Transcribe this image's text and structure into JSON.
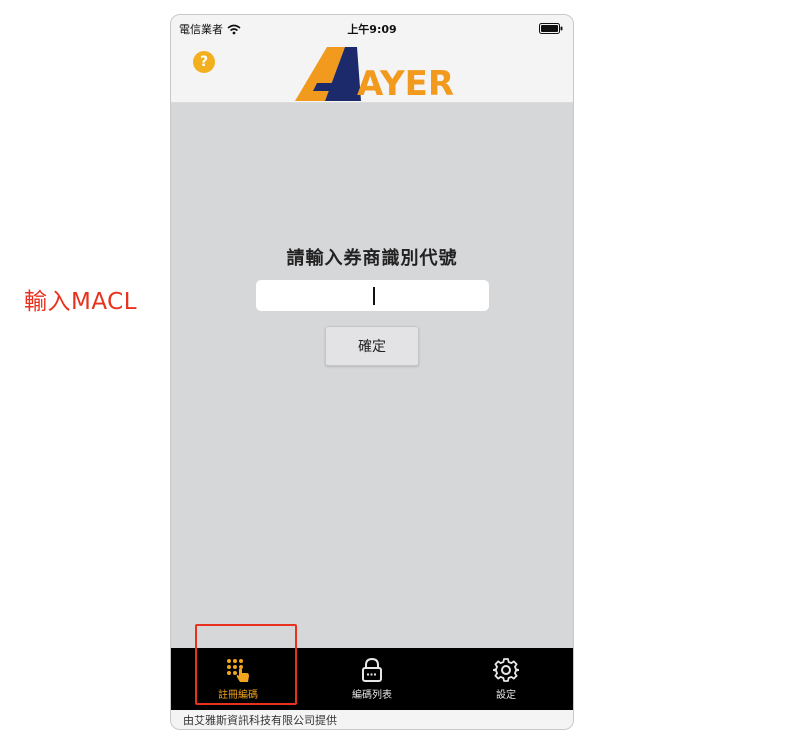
{
  "annotation": {
    "label": "輸入MACL",
    "color": "#e8321e"
  },
  "status_bar": {
    "carrier": "電信業者",
    "time": "上午9:09"
  },
  "header": {
    "help_icon": "?",
    "logo_text": "AYERS",
    "logo_colors": {
      "orange": "#f29a1e",
      "navy": "#1c2a6b"
    }
  },
  "main": {
    "prompt": "請輸入券商識別代號",
    "input": {
      "value": "",
      "placeholder": ""
    },
    "confirm_label": "確定"
  },
  "tabs": [
    {
      "label": "註冊編碼",
      "icon": "keypad-hand-icon",
      "active": true
    },
    {
      "label": "編碼列表",
      "icon": "lock-list-icon",
      "active": false
    },
    {
      "label": "設定",
      "icon": "gear-icon",
      "active": false
    }
  ],
  "footer": {
    "text": "由艾雅斯資訊科技有限公司提供"
  },
  "colors": {
    "accent": "#f2a41e",
    "content_bg": "#d6d7d9",
    "tab_bar_bg": "#000000"
  }
}
